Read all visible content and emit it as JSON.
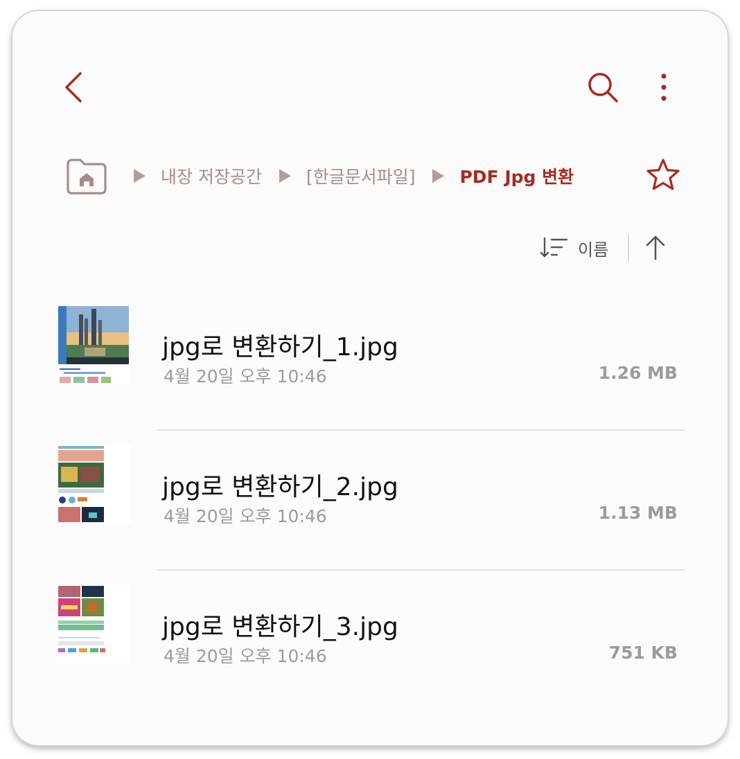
{
  "topbar": {
    "back_icon": "chevron-left-icon",
    "search_icon": "search-icon",
    "more_icon": "more-vertical-icon",
    "accent_color": "#a52b20"
  },
  "breadcrumb": {
    "home_icon": "home-folder-icon",
    "items": [
      {
        "label": "내장 저장공간"
      },
      {
        "label": "[한글문서파일]"
      },
      {
        "label": "PDF Jpg 변환"
      }
    ],
    "favorite_icon": "star-icon"
  },
  "sort": {
    "icon": "sort-icon",
    "label": "이름",
    "order_icon": "arrow-up-icon"
  },
  "files": [
    {
      "name": "jpg로 변환하기_1.jpg",
      "date": "4월 20일 오후 10:46",
      "size": "1.26 MB"
    },
    {
      "name": "jpg로 변환하기_2.jpg",
      "date": "4월 20일 오후 10:46",
      "size": "1.13 MB"
    },
    {
      "name": "jpg로 변환하기_3.jpg",
      "date": "4월 20일 오후 10:46",
      "size": "751 KB"
    }
  ]
}
